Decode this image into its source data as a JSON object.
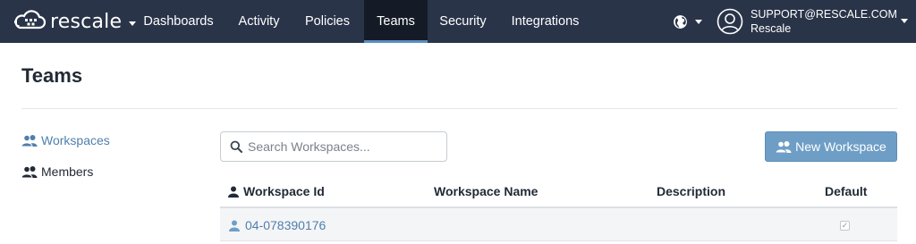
{
  "brand": {
    "name": "rescale"
  },
  "nav": {
    "items": [
      {
        "label": "Dashboards"
      },
      {
        "label": "Activity"
      },
      {
        "label": "Policies"
      },
      {
        "label": "Teams",
        "active": true
      },
      {
        "label": "Security"
      },
      {
        "label": "Integrations"
      }
    ]
  },
  "user": {
    "email": "SUPPORT@RESCALE.COM",
    "org": "Rescale"
  },
  "page": {
    "title": "Teams"
  },
  "sidebar": {
    "items": [
      {
        "label": "Workspaces",
        "icon": "users-icon",
        "active": true
      },
      {
        "label": "Members",
        "icon": "users-icon",
        "active": false
      }
    ]
  },
  "search": {
    "placeholder": "Search Workspaces...",
    "value": ""
  },
  "buttons": {
    "new_workspace": "New Workspace"
  },
  "table": {
    "columns": [
      "Workspace Id",
      "Workspace Name",
      "Description",
      "Default"
    ],
    "rows": [
      {
        "id": "04-078390176",
        "name": "",
        "description": "",
        "default": true
      }
    ]
  },
  "colors": {
    "nav_bg": "#2a3449",
    "nav_active_bg": "#141b26",
    "nav_active_underline": "#5b8fc2",
    "link": "#4f7fac",
    "button_bg": "#6e9ec6"
  }
}
